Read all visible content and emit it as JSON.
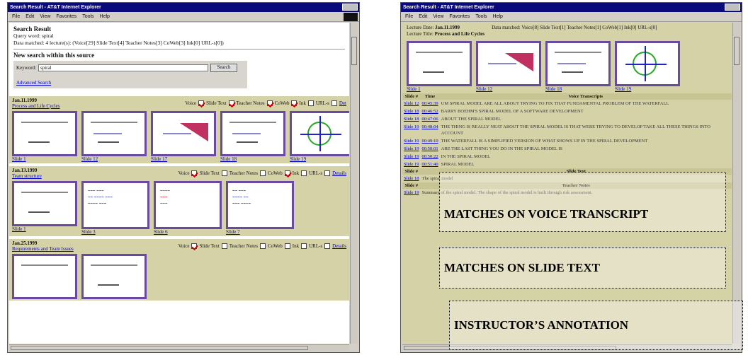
{
  "left_window": {
    "title": "Search Result - AT&T Internet Explorer",
    "menu": [
      "File",
      "Edit",
      "View",
      "Favorites",
      "Tools",
      "Help"
    ],
    "search_result": {
      "heading": "Search Result",
      "query_line": "Query word: spiral",
      "data_line": "Data matched: 4 lecture(s): (Voice[29] Slide Text[4] Teacher Notes[3] CoWeb[3] Ink[0] URL-s[0])"
    },
    "new_search": {
      "heading": "New search within this source",
      "keyword_label": "Keyword:",
      "keyword_value": "spiral",
      "button": "Search",
      "advanced": "Advanced Search"
    },
    "lectures": [
      {
        "date": "Jan.11.1999",
        "title": "Process and Life Cycles",
        "filters": [
          {
            "label": "Voice",
            "checked": true
          },
          {
            "label": "Slide Text",
            "checked": true
          },
          {
            "label": "Teacher Notes",
            "checked": true
          },
          {
            "label": "CoWeb",
            "checked": true
          },
          {
            "label": "Ink",
            "checked": false
          },
          {
            "label": "URL-s",
            "checked": false
          }
        ],
        "details": "Det",
        "slides": [
          "Slide 1",
          "Slide 12",
          "Slide 17",
          "Slide 18",
          "Slide 19"
        ]
      },
      {
        "date": "Jan.13.1999",
        "title": "Team structure",
        "filters": [
          {
            "label": "Voice",
            "checked": true
          },
          {
            "label": "Slide Text",
            "checked": false
          },
          {
            "label": "Teacher Notes",
            "checked": false
          },
          {
            "label": "CoWeb",
            "checked": true
          },
          {
            "label": "Ink",
            "checked": false
          },
          {
            "label": "URL-s",
            "checked": false
          }
        ],
        "details": "Details",
        "slides": [
          "Slide 1",
          "Slide 3",
          "Slide 6",
          "Slide 7"
        ]
      },
      {
        "date": "Jan.25.1999",
        "title": "Requirements and Team Issues",
        "filters": [
          {
            "label": "Voice",
            "checked": true
          },
          {
            "label": "Slide Text",
            "checked": false
          },
          {
            "label": "Teacher Notes",
            "checked": false
          },
          {
            "label": "CoWeb",
            "checked": false
          },
          {
            "label": "Ink",
            "checked": false
          },
          {
            "label": "URL-s",
            "checked": false
          }
        ],
        "details": "Details",
        "slides": []
      }
    ]
  },
  "right_window": {
    "title": "Search Result - AT&T Internet Explorer",
    "menu": [
      "File",
      "Edit",
      "View",
      "Favorites",
      "Tools",
      "Help"
    ],
    "lecture_date_label": "Lecture Date:",
    "lecture_date": "Jan.11.1999",
    "lecture_title_label": "Lecture Title:",
    "lecture_title": "Process and Life Cycles",
    "data_matched": "Data matched: Voice[8] Slide Text[1] Teacher Notes[1] CoWeb[1] Ink[0] URL-s[0]",
    "slides": [
      "Slide 1",
      "Slide 12",
      "Slide 18",
      "Slide 19"
    ],
    "voice_header": [
      "Slide #",
      "Time",
      "Voice Transcripts"
    ],
    "voice_rows": [
      {
        "slide": "Slide 12",
        "time": "00:45:39",
        "text": "UM SPIRAL MODEL ARE ALL ABOUT TRYING TO FIX THAT FUNDAMENTAL PROBLEM OF THE WATERFALL"
      },
      {
        "slide": "Slide 18",
        "time": "00:46:52",
        "text": "BARRY BOEHM'S SPIRAL MODEL OF A SOFTWARE DEVELOPMENT"
      },
      {
        "slide": "Slide 18",
        "time": "00:47:06",
        "text": "ABOUT THE SPIRAL MODEL"
      },
      {
        "slide": "Slide 19",
        "time": "00:48:04",
        "text": "THE THING IS REALLY NEAT ABOUT THE SPIRAL MODEL IS THAT WERE TRYING TO DEVELOP TAKE ALL THESE THINGS INTO ACCOUNT"
      },
      {
        "slide": "Slide 19",
        "time": "00:49:10",
        "text": "THE WATERFALL IS A SIMPLIFIED VERSION OF WHAT SHOWS UP IN THE SPIRAL DEVELOPMENT"
      },
      {
        "slide": "Slide 19",
        "time": "00:50:01",
        "text": "ARE THE LAST THING YOU DO IN THE SPIRAL MODEL IS"
      },
      {
        "slide": "Slide 19",
        "time": "00:50:22",
        "text": "IN THE SPIRAL MODEL"
      },
      {
        "slide": "Slide 19",
        "time": "00:51:40",
        "text": "SPIRAL MODEL"
      }
    ],
    "slide_text_header": [
      "Slide #",
      "Slide Text"
    ],
    "slide_text_rows": [
      {
        "slide": "Slide 18",
        "text": "The spiral model"
      }
    ],
    "teacher_header": [
      "Slide #",
      "Teacher Notes"
    ],
    "teacher_rows": [
      {
        "slide": "Slide 19",
        "text": "Summary of the spiral model. The shape of the spiral model is built through risk assessment."
      }
    ]
  },
  "overlays": {
    "voice": "MATCHES ON VOICE TRANSCRIPT",
    "slide_text": "MATCHES ON SLIDE TEXT",
    "annotation": "INSTRUCTOR’S ANNOTATION"
  }
}
